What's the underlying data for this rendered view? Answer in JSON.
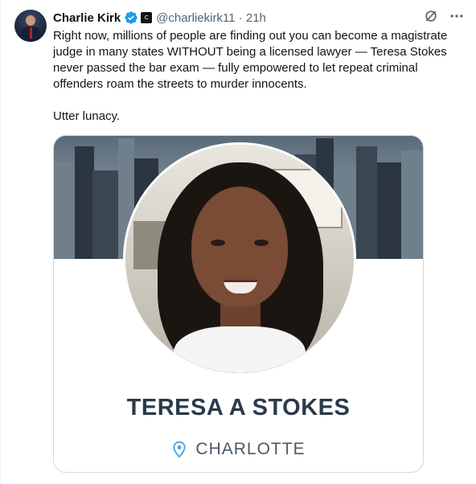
{
  "tweet": {
    "author_name": "Charlie Kirk",
    "handle_time": "@charliekirk11 · 21h",
    "affiliation_badge": "C",
    "text_paragraph_1": "Right now, millions of people are finding out you can become a magistrate judge in many states WITHOUT being a licensed lawyer — Teresa Stokes never passed the bar exam — fully empowered to let repeat criminal offenders roam the streets to murder innocents.",
    "text_paragraph_2": "Utter lunacy."
  },
  "media": {
    "person_name": "TERESA A STOKES",
    "location": "CHARLOTTE"
  },
  "icons": {
    "verified": "verified-badge-icon",
    "grok": "grok-icon",
    "more": "more-icon",
    "pin": "location-pin-icon"
  },
  "colors": {
    "verified_blue": "#1d9bf0",
    "secondary_text": "#536471",
    "name_text": "#2b3a47",
    "pin_blue": "#4aa3df"
  }
}
